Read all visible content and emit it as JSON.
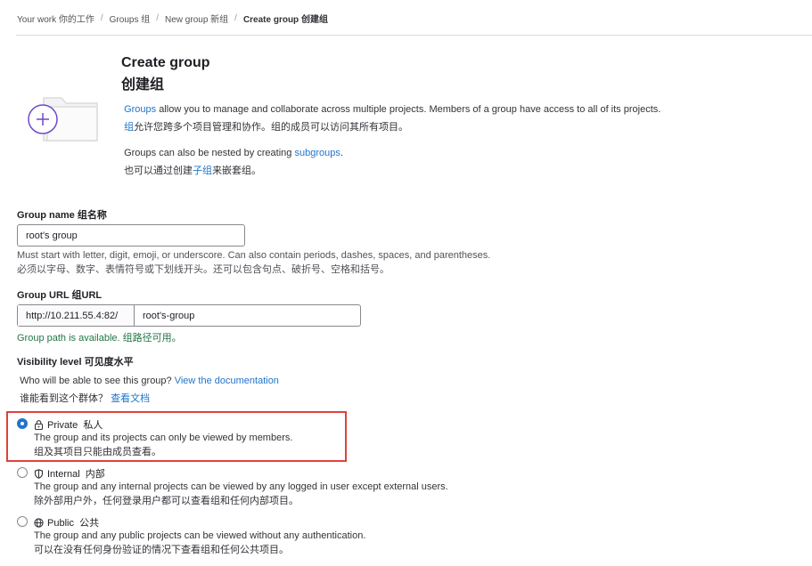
{
  "breadcrumb": {
    "items": [
      "Your work 你的工作",
      "Groups 组",
      "New group 新组",
      "Create group 创建组"
    ]
  },
  "header": {
    "title_en": "Create group",
    "title_zh": "创建组"
  },
  "intro": {
    "line1_link": "Groups",
    "line1_rest": " allow you to manage and collaborate across multiple projects. Members of a group have access to all of its projects.",
    "line2_link": "组",
    "line2_rest": "允许您跨多个项目管理和协作。组的成员可以访问其所有项目。",
    "line3_pre": "Groups can also be nested by creating ",
    "line3_link": "subgroups",
    "line3_post": ".",
    "line4_pre": "也可以通过创建",
    "line4_link": "子组",
    "line4_post": "来嵌套组。"
  },
  "group_name": {
    "label": "Group name  组名称",
    "value": "root's group",
    "help_en": "Must start with letter, digit, emoji, or underscore. Can also contain periods, dashes, spaces, and parentheses.",
    "help_zh": "必须以字母、数字、表情符号或下划线开头。还可以包含句点、破折号、空格和括号。"
  },
  "group_url": {
    "label": "Group URL  组URL",
    "prefix": "http://10.211.55.4:82/",
    "path": "root's-group",
    "status": "Group path is available. 组路径可用。"
  },
  "visibility": {
    "label": "Visibility level  可见度水平",
    "question_en": "Who will be able to see this group? ",
    "doc_link_en": "View the documentation",
    "question_zh": "谁能看到这个群体？ ",
    "doc_link_zh": "查看文档",
    "options": [
      {
        "name": "Private  私人",
        "icon": "lock-icon",
        "desc_en": "The group and its projects can only be viewed by members.",
        "desc_zh": "组及其项目只能由成员查看。",
        "selected": true
      },
      {
        "name": "Internal  内部",
        "icon": "shield-icon",
        "desc_en": "The group and any internal projects can be viewed by any logged in user except external users.",
        "desc_zh": "除外部用户外，任何登录用户都可以查看组和任何内部项目。",
        "selected": false
      },
      {
        "name": "Public  公共",
        "icon": "globe-icon",
        "desc_en": "The group and any public projects can be viewed without any authentication.",
        "desc_zh": "可以在没有任何身份验证的情况下查看组和任何公共项目。",
        "selected": false
      }
    ]
  },
  "colors": {
    "link": "#1f75cb",
    "success": "#217645",
    "highlight": "#e0403a",
    "illustration_accent": "#6e49cb"
  }
}
